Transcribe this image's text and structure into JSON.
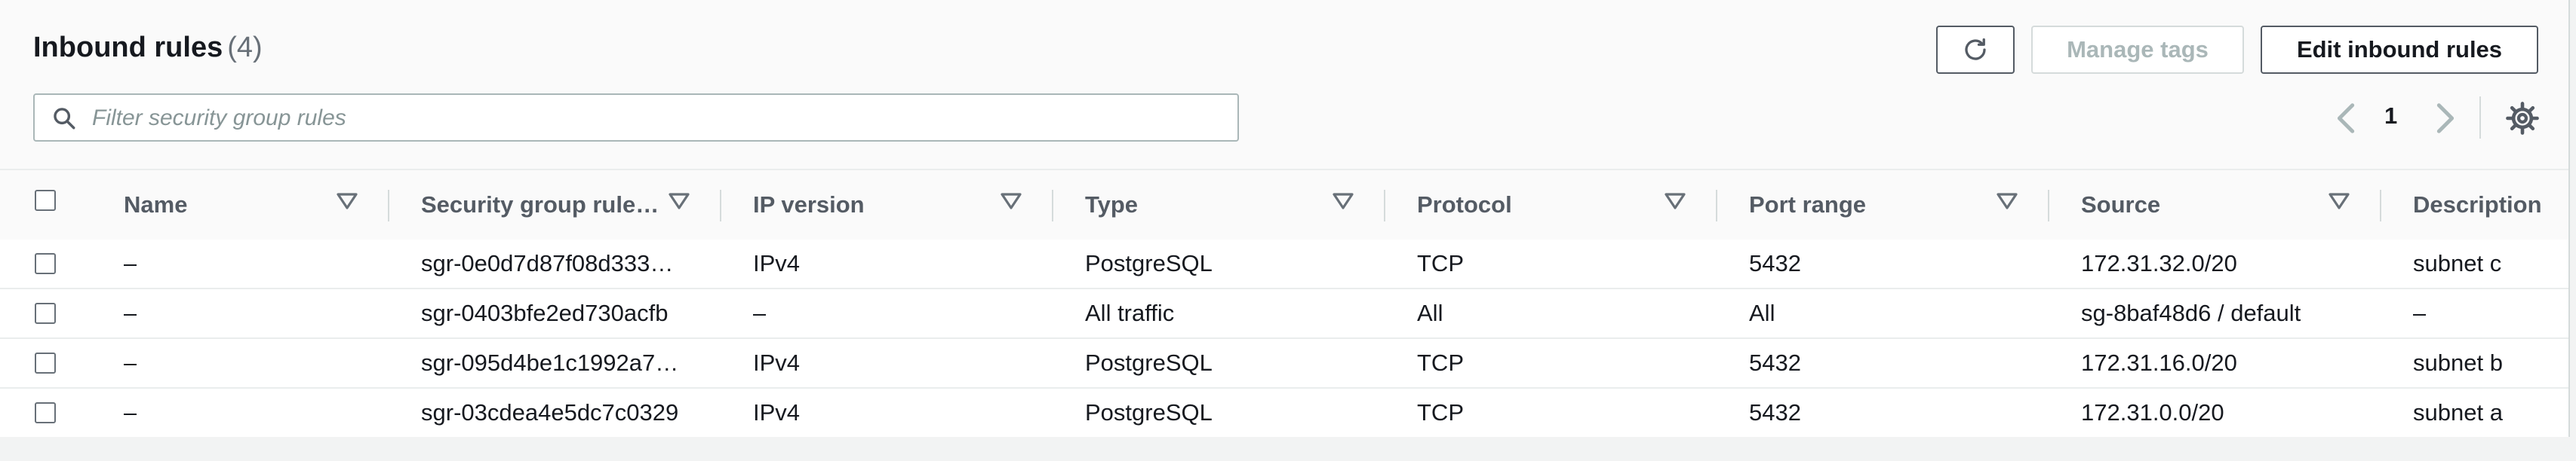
{
  "header": {
    "title": "Inbound rules",
    "count": "(4)",
    "refresh_icon": "refresh-icon",
    "manage_tags_label": "Manage tags",
    "edit_label": "Edit inbound rules"
  },
  "search": {
    "placeholder": "Filter security group rules",
    "value": "",
    "icon": "search-icon"
  },
  "pagination": {
    "current_page": "1",
    "prev_icon": "chevron-left-icon",
    "next_icon": "chevron-right-icon",
    "settings_icon": "gear-icon"
  },
  "table": {
    "columns": [
      "Name",
      "Security group rule…",
      "IP version",
      "Type",
      "Protocol",
      "Port range",
      "Source",
      "Description"
    ],
    "rows": [
      [
        "–",
        "sgr-0e0d7d87f08d333…",
        "IPv4",
        "PostgreSQL",
        "TCP",
        "5432",
        "172.31.32.0/20",
        "subnet c"
      ],
      [
        "–",
        "sgr-0403bfe2ed730acfb",
        "–",
        "All traffic",
        "All",
        "All",
        "sg-8baf48d6 / default",
        "–"
      ],
      [
        "–",
        "sgr-095d4be1c1992a7…",
        "IPv4",
        "PostgreSQL",
        "TCP",
        "5432",
        "172.31.16.0/20",
        "subnet b"
      ],
      [
        "–",
        "sgr-03cdea4e5dc7c0329",
        "IPv4",
        "PostgreSQL",
        "TCP",
        "5432",
        "172.31.0.0/20",
        "subnet a"
      ]
    ]
  },
  "colors": {
    "primary_text": "#16191f",
    "secondary_text": "#545b64",
    "border": "#d5dbdb",
    "disabled": "#aab7b8"
  }
}
